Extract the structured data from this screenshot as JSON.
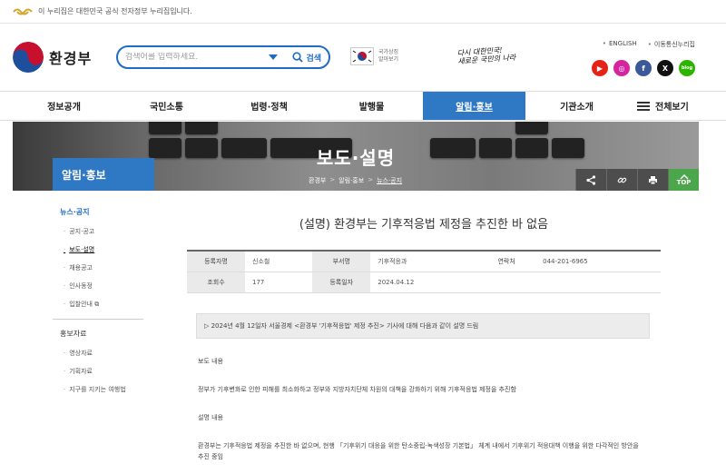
{
  "topbar": {
    "text": "이 누리집은 대한민국 공식 전자정부 누리집입니다."
  },
  "header": {
    "logo_text": "환경부",
    "search_placeholder": "검색어를 입력하세요.",
    "search_button": "검색",
    "flag_text_line1": "국가상징",
    "flag_text_line2": "알아보기",
    "slogan_line1": "다시 대한민국!",
    "slogan_line2": "새로운 국민의 나라",
    "util_links": [
      "ENGLISH",
      "이동통신누리집"
    ],
    "social": [
      {
        "name": "youtube",
        "label": "▶",
        "color": "#e62117"
      },
      {
        "name": "instagram",
        "label": "◎",
        "color": "#d6249f"
      },
      {
        "name": "facebook",
        "label": "f",
        "color": "#3b5998"
      },
      {
        "name": "x",
        "label": "X",
        "color": "#111111"
      },
      {
        "name": "blog",
        "label": "blog",
        "color": "#2db400"
      }
    ]
  },
  "gnb": {
    "items": [
      "정보공개",
      "국민소통",
      "법령·정책",
      "발행물",
      "알림·홍보",
      "기관소개"
    ],
    "active_index": 4,
    "all_menu": "전체보기"
  },
  "banner": {
    "title": "보도·설명",
    "breadcrumb": [
      "환경부",
      "알림·홍보",
      "뉴스·공지"
    ],
    "top_label": "TOP"
  },
  "lnb": {
    "title": "알림·홍보",
    "cat1": "뉴스·공지",
    "cat1_items": [
      "공지·공고",
      "보도·설명",
      "채용공고",
      "인사동정",
      "입찰안내"
    ],
    "cat1_active": 1,
    "cat2": "홍보자료",
    "cat2_items": [
      "영상자료",
      "기획자료",
      "지구를 지키는 여행법"
    ]
  },
  "article": {
    "title": "(설명) 환경부는 기후적응법 제정을 추진한 바 없음",
    "meta": {
      "author_label": "등록자명",
      "author": "신소철",
      "dept_label": "부서명",
      "dept": "기후적응과",
      "phone_label": "연락처",
      "phone": "044-201-6965",
      "views_label": "조회수",
      "views": "177",
      "date_label": "등록일자",
      "date": "2024.04.12"
    },
    "notice": "▷ 2024년 4월 12일자 서울경제 <환경부 '기후적응법' 제정 추진> 기사에 대해 다음과 같이 설명 드림",
    "section1_title": "보도 내용",
    "section1_body": "정부가 기후변화로 인한 피해를 최소화하고 정부와 지방자치단체 차원의 대책을 강화하기 위해 기후적응법 제정을 추진함",
    "section2_title": "설명 내용",
    "section2_body_line1": "환경부는 기후적응법 제정을 추진한 바 없으며, 현행 「기후위기 대응을 위한 탄소중립·녹색성장 기본법」 체계 내에서 기후위기 적응대책 이행을 위한 다각적인 방안을",
    "section2_body_line2": "추진 중임"
  }
}
